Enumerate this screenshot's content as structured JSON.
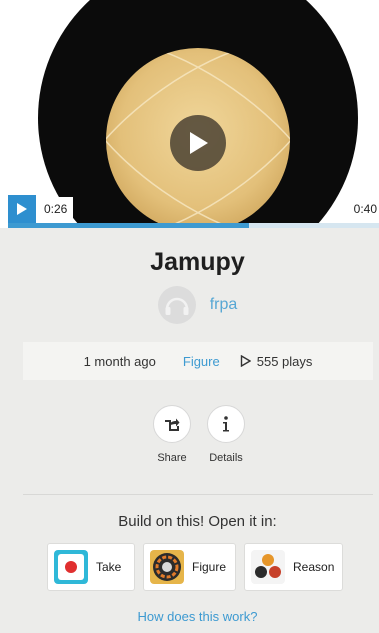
{
  "player": {
    "current_time": "0:26",
    "total_time": "0:40",
    "progress_fraction": 0.65
  },
  "track": {
    "title": "Jamupy",
    "author": "frpa"
  },
  "meta": {
    "date": "1 month ago",
    "app": "Figure",
    "plays": "555 plays"
  },
  "actions": {
    "share_label": "Share",
    "details_label": "Details"
  },
  "build": {
    "heading": "Build on this! Open it in:",
    "apps": [
      {
        "label": "Take",
        "icon": "take-app-icon"
      },
      {
        "label": "Figure",
        "icon": "figure-app-icon"
      },
      {
        "label": "Reason",
        "icon": "reason-app-icon"
      }
    ],
    "help_link": "How does this work?"
  },
  "colors": {
    "accent": "#3d9ad1",
    "record_black": "#0b0b0b",
    "label_gold": "#e7c886"
  }
}
